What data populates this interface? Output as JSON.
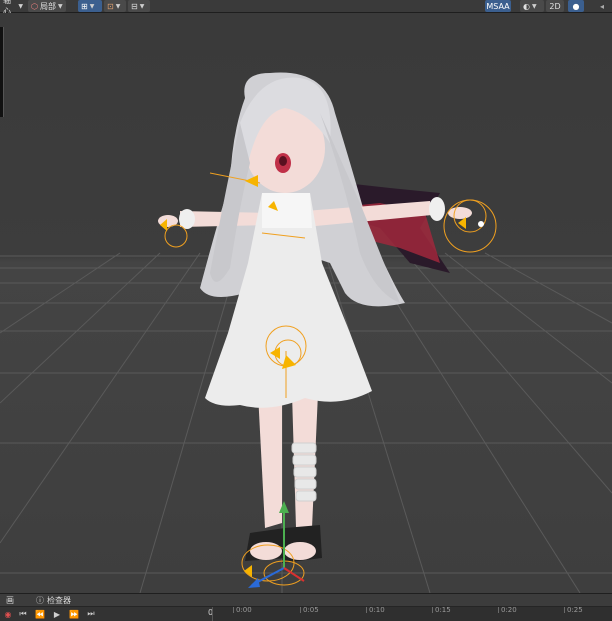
{
  "toolbar": {
    "pivot_label": "轴心",
    "local_label": "局部",
    "msaa_label": "MSAA",
    "mode_2d_label": "2D"
  },
  "tabs": {
    "left_label": "画",
    "inspector_label": "检查器"
  },
  "timeline": {
    "frame_value": "0",
    "ticks": [
      "0:00",
      "0:05",
      "0:10",
      "0:15",
      "0:20",
      "0:25"
    ]
  },
  "colors": {
    "gizmo_orange": "#f0a020",
    "wing_dark": "#2a1a2a",
    "wing_red": "#a0283c",
    "skin": "#f3dcd8"
  }
}
